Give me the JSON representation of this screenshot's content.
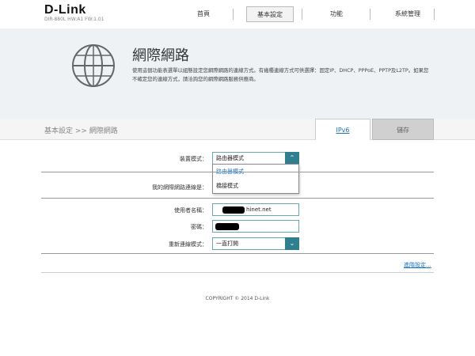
{
  "header": {
    "logo": "D-Link",
    "model": "DIR-880L    HW:A1    FW:1.01",
    "nav": [
      "首頁",
      "基本設定",
      "功能",
      "系統管理"
    ],
    "active_nav": "基本設定"
  },
  "banner": {
    "title": "網際網路",
    "description": "使用這個功能表選單以組態設定您網際網路的連線方式。有幾種連線方式可供選擇：固定IP、DHCP、PPPoE、PPTP及L2TP。如果您不確定您的連線方式，請洽詢您的網際網路服務供應商。"
  },
  "breadcrumb": "基本設定 >> 網際網路",
  "buttons": {
    "ipv6": "IPv6",
    "save": "儲存",
    "advanced": "進階設定..."
  },
  "form": {
    "device_mode_label": "裝置模式：",
    "device_mode_value": "路由器模式",
    "device_mode_options": [
      "路由器模式",
      "橋接模式"
    ],
    "connection_type_label": "我的網際網路連線是：",
    "username_label": "使用者名稱：",
    "username_value": "hinet.net",
    "password_label": "密碼：",
    "reconnect_label": "重新連線模式：",
    "reconnect_value": "一直打開"
  },
  "footer": "COPYRIGHT © 2014 D-Link",
  "colors": {
    "accent": "#2f7f8f",
    "link": "#1a73c5",
    "banner_bg": "#eef2f5"
  },
  "icons": {
    "banner": "globe-icon",
    "dropdown": "chevron-down-icon"
  }
}
